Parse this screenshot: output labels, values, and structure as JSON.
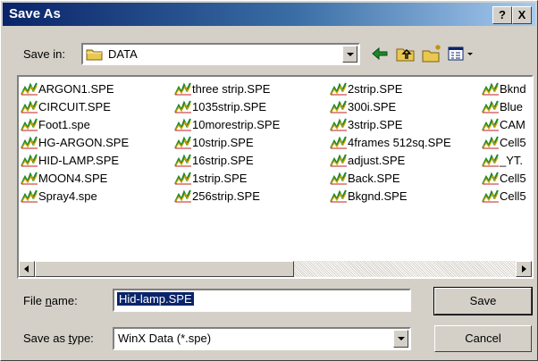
{
  "window": {
    "title": "Save As",
    "help_glyph": "?",
    "close_glyph": "X"
  },
  "save_in": {
    "label": "Save in:",
    "value": "DATA"
  },
  "files": [
    [
      "ARGON1.SPE",
      "CIRCUIT.SPE",
      "Foot1.spe",
      "HG-ARGON.SPE",
      "HID-LAMP.SPE",
      "MOON4.SPE",
      "Spray4.spe"
    ],
    [
      "three strip.SPE",
      "1035strip.SPE",
      "10morestrip.SPE",
      "10strip.SPE",
      "16strip.SPE",
      "1strip.SPE",
      "256strip.SPE"
    ],
    [
      "2strip.SPE",
      "300i.SPE",
      "3strip.SPE",
      "4frames 512sq.SPE",
      "adjust.SPE",
      "Back.SPE",
      "Bkgnd.SPE"
    ],
    [
      "Bknd",
      "Blue",
      "CAM",
      "Cell5",
      "_YT.",
      "Cell5",
      "Cell5"
    ]
  ],
  "file_name": {
    "label": "File name:",
    "value": "Hid-lamp.SPE"
  },
  "save_as_type": {
    "label": "Save as type:",
    "value": "WinX Data (*.spe)"
  },
  "buttons": {
    "save": "Save",
    "cancel": "Cancel"
  },
  "colors": {
    "title_start": "#0a246a",
    "title_end": "#a6caf0",
    "selection": "#0a246a",
    "face": "#d4d0c8"
  },
  "icons": [
    "folder-icon",
    "back-arrow-icon",
    "up-folder-icon",
    "new-folder-icon",
    "view-menu-icon",
    "spectrum-file-icon"
  ]
}
